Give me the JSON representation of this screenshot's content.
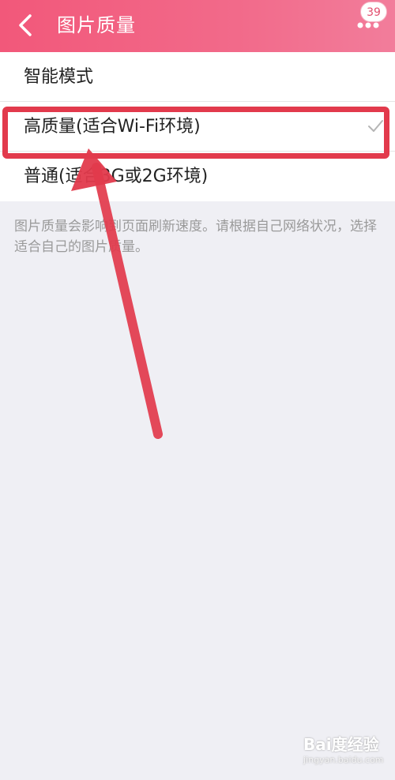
{
  "header": {
    "title": "图片质量",
    "notification_count": "39",
    "back_icon": "chevron-left-icon",
    "more_icon": "more-dots-icon",
    "gradient_colors": [
      "#f2587a",
      "#f27d9b"
    ]
  },
  "options": [
    {
      "label": "智能模式",
      "selected": false
    },
    {
      "label": "高质量(适合Wi-Fi环境)",
      "selected": true
    },
    {
      "label": "普通(适合3G或2G环境)",
      "selected": false
    }
  ],
  "hint": "图片质量会影响到页面刷新速度。请根据自己网络状况，选择适合自己的图片质量。",
  "annotation": {
    "color": "#e23a4c"
  },
  "watermark": {
    "brand": "Bai度经验",
    "url": "jingyan.baidu.com"
  }
}
